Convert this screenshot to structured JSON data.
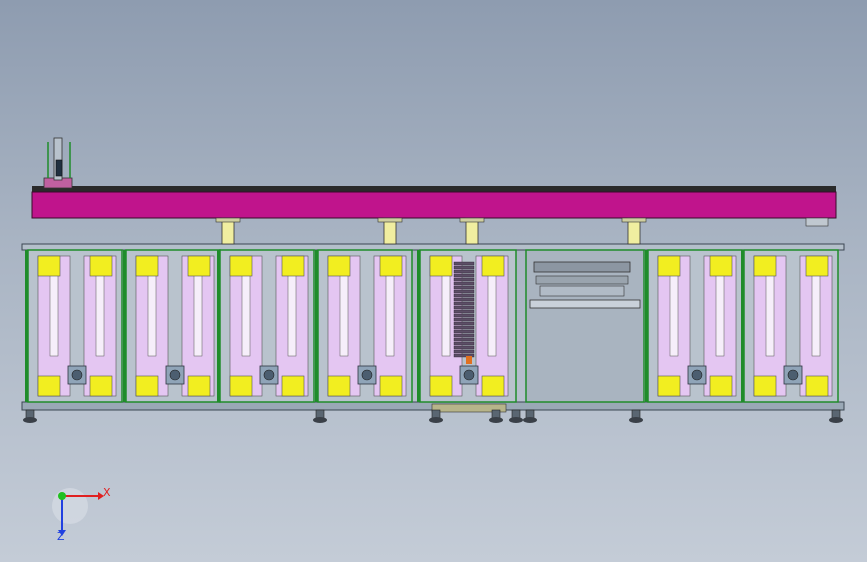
{
  "triad": {
    "x_label": "X",
    "z_label": "Z",
    "x_color": "#e02020",
    "y_color": "#20c020",
    "z_color": "#2040e0"
  },
  "colors": {
    "background_top": "#8e9cb0",
    "background_bottom": "#c4ccd7",
    "beam": "#c0148c",
    "panel": "#e4c6f2",
    "bracket": "#f2ee20",
    "frame": "#7d8fa0",
    "frame_green": "#1f8c2a",
    "support": "#f0eea0"
  },
  "machine": {
    "cabinet_count": 7,
    "has_overhead_beam": true,
    "has_center_station": true
  }
}
